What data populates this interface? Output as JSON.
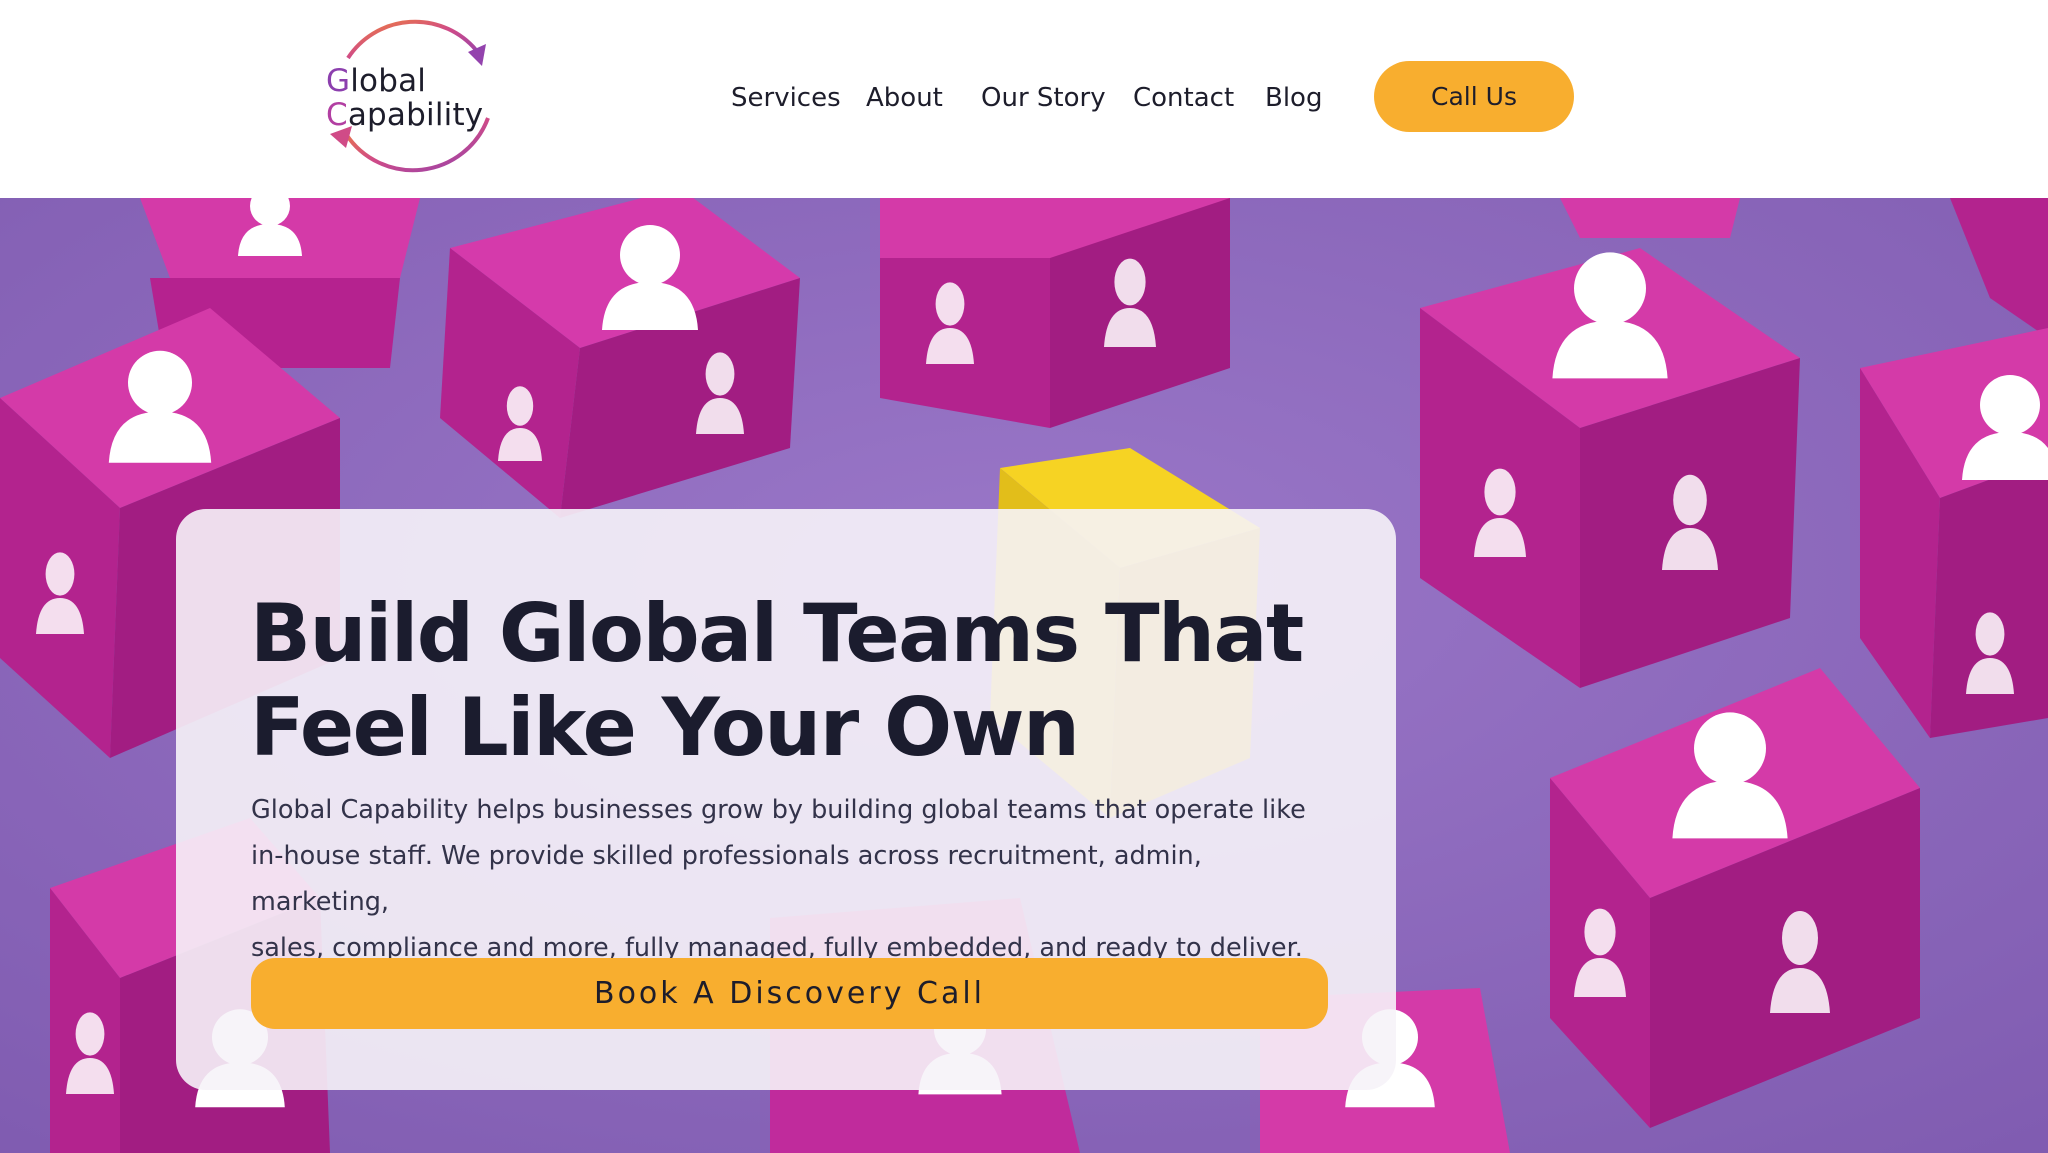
{
  "header": {
    "logo": {
      "line1_initial": "G",
      "line1_rest": "lobal",
      "line2_initial": "C",
      "line2_rest": "apability"
    },
    "nav": [
      {
        "label": "Services"
      },
      {
        "label": "About"
      },
      {
        "label": "Our Story"
      },
      {
        "label": "Contact"
      },
      {
        "label": "Blog"
      }
    ],
    "call_button": "Call Us"
  },
  "hero": {
    "headline_line1": "Build Global Teams That",
    "headline_line2": "Feel Like Your Own",
    "body_line1": "Global Capability helps businesses grow by building global teams that operate like",
    "body_line2": "in-house staff. We provide skilled professionals across recruitment, admin, marketing,",
    "body_line3": "sales, compliance and more, fully managed, fully embedded, and ready to deliver.",
    "cta_label": "Book A Discovery Call"
  },
  "colors": {
    "accent": "#f8ae2f",
    "hero_background": "#8f6bc0",
    "cube_magenta": "#c8269e",
    "cube_yellow": "#f6d323",
    "text_dark": "#1b1c2e"
  }
}
